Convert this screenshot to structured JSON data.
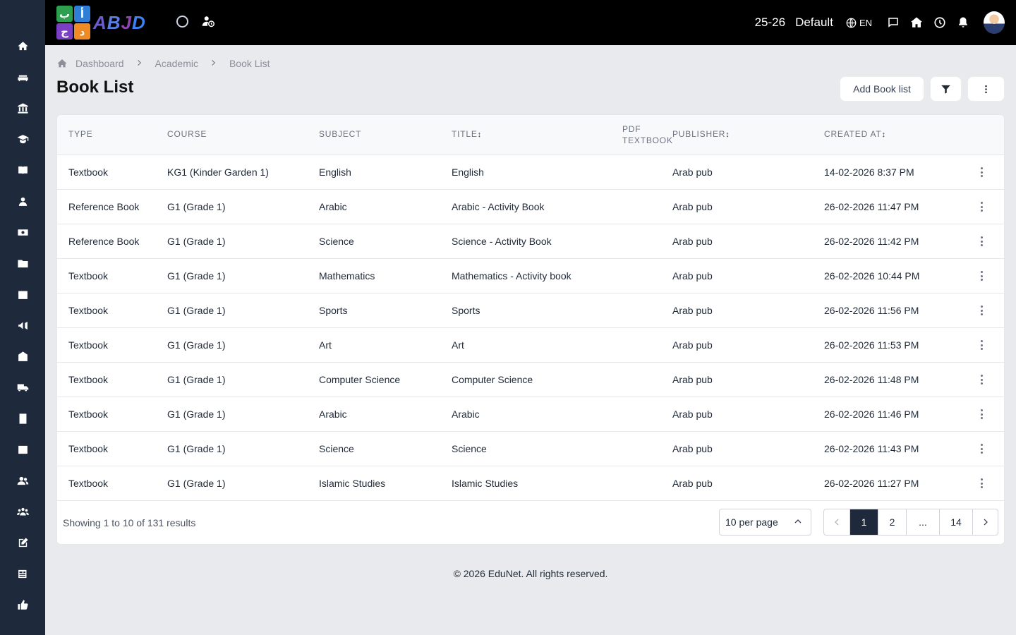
{
  "colors": {
    "sidebar": "#1e2a3c",
    "topbar": "#000000",
    "active_page": "#1e2a3c"
  },
  "sidebar": {
    "items": [
      {
        "icon": "home-icon"
      },
      {
        "icon": "sofa-icon"
      },
      {
        "icon": "institution-icon"
      },
      {
        "icon": "graduate-icon"
      },
      {
        "icon": "book-icon"
      },
      {
        "icon": "user-icon"
      },
      {
        "icon": "money-icon"
      },
      {
        "icon": "folder-icon"
      },
      {
        "icon": "calendar-icon"
      },
      {
        "icon": "megaphone-icon"
      },
      {
        "icon": "school-icon"
      },
      {
        "icon": "truck-icon"
      },
      {
        "icon": "notebook-icon"
      },
      {
        "icon": "image-icon"
      },
      {
        "icon": "users-icon"
      },
      {
        "icon": "group-icon"
      },
      {
        "icon": "edit-icon"
      },
      {
        "icon": "news-icon"
      },
      {
        "icon": "thumbs-up-icon"
      }
    ]
  },
  "topbar": {
    "logo_glyphs": [
      "ب",
      "أ",
      "ج",
      "د"
    ],
    "logo_text": [
      "A",
      "B",
      "J",
      "D"
    ],
    "academic_year": "25-26",
    "scheme": "Default",
    "language": "EN"
  },
  "breadcrumb": {
    "home": "Dashboard",
    "section": "Academic",
    "current": "Book List"
  },
  "page": {
    "title": "Book List",
    "add_button": "Add Book list"
  },
  "table": {
    "headers": {
      "type": "TYPE",
      "course": "COURSE",
      "subject": "SUBJECT",
      "title": "TITLE",
      "pdf_line1": "PDF",
      "pdf_line2": "TEXTBOOK",
      "publisher": "PUBLISHER",
      "created_at": "CREATED AT"
    },
    "sort_glyph": "↕",
    "rows": [
      {
        "type": "Textbook",
        "course": "KG1 (Kinder Garden 1)",
        "subject": "English",
        "title": "English",
        "publisher": "Arab pub",
        "created_at": "14-02-2026 8:37 PM"
      },
      {
        "type": "Reference Book",
        "course": "G1 (Grade 1)",
        "subject": "Arabic",
        "title": "Arabic - Activity Book",
        "publisher": "Arab pub",
        "created_at": "26-02-2026 11:47 PM"
      },
      {
        "type": "Reference Book",
        "course": "G1 (Grade 1)",
        "subject": "Science",
        "title": "Science - Activity Book",
        "publisher": "Arab pub",
        "created_at": "26-02-2026 11:42 PM"
      },
      {
        "type": "Textbook",
        "course": "G1 (Grade 1)",
        "subject": "Mathematics",
        "title": "Mathematics - Activity book",
        "publisher": "Arab pub",
        "created_at": "26-02-2026 10:44 PM"
      },
      {
        "type": "Textbook",
        "course": "G1 (Grade 1)",
        "subject": "Sports",
        "title": "Sports",
        "publisher": "Arab pub",
        "created_at": "26-02-2026 11:56 PM"
      },
      {
        "type": "Textbook",
        "course": "G1 (Grade 1)",
        "subject": "Art",
        "title": "Art",
        "publisher": "Arab pub",
        "created_at": "26-02-2026 11:53 PM"
      },
      {
        "type": "Textbook",
        "course": "G1 (Grade 1)",
        "subject": "Computer Science",
        "title": "Computer Science",
        "publisher": "Arab pub",
        "created_at": "26-02-2026 11:48 PM"
      },
      {
        "type": "Textbook",
        "course": "G1 (Grade 1)",
        "subject": "Arabic",
        "title": "Arabic",
        "publisher": "Arab pub",
        "created_at": "26-02-2026 11:46 PM"
      },
      {
        "type": "Textbook",
        "course": "G1 (Grade 1)",
        "subject": "Science",
        "title": "Science",
        "publisher": "Arab pub",
        "created_at": "26-02-2026 11:43 PM"
      },
      {
        "type": "Textbook",
        "course": "G1 (Grade 1)",
        "subject": "Islamic Studies",
        "title": "Islamic Studies",
        "publisher": "Arab pub",
        "created_at": "26-02-2026 11:27 PM"
      }
    ]
  },
  "pagination": {
    "summary": "Showing 1 to 10 of 131 results",
    "per_page": "10 per page",
    "pages": [
      "1",
      "2",
      "...",
      "14"
    ],
    "active_page": "1"
  },
  "footer": "© 2026 EduNet. All rights reserved."
}
